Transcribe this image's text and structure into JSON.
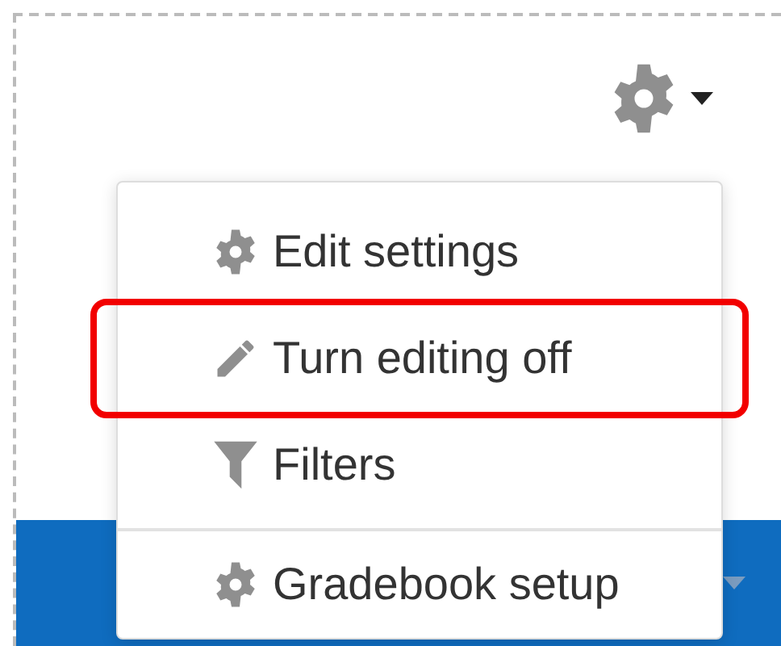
{
  "settings_menu": {
    "expanded": true,
    "items": [
      {
        "kind": "gear",
        "label": "Edit settings",
        "highlighted": false,
        "divider_before": false
      },
      {
        "kind": "pencil",
        "label": "Turn editing off",
        "highlighted": true,
        "divider_before": false
      },
      {
        "kind": "filter",
        "label": "Filters",
        "highlighted": false,
        "divider_before": false
      },
      {
        "kind": "gear",
        "label": "Gradebook setup",
        "highlighted": false,
        "divider_before": true
      }
    ]
  }
}
